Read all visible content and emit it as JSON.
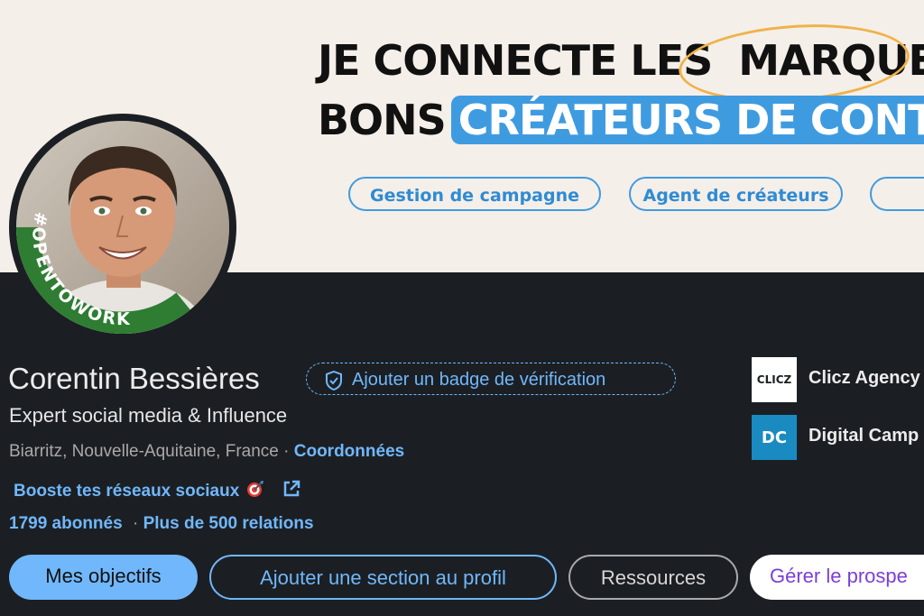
{
  "banner": {
    "line1_part1": "JE CONNECTE LES",
    "line1_part2": "MARQUES A",
    "line2_part1": "BONS",
    "line2_part2": "CRÉATEURS DE CONTEN",
    "pills": [
      "Gestion de campagne",
      "Agent de créateurs",
      ""
    ],
    "colors": {
      "accent_blue": "#3f9be0",
      "highlight_circle": "#f0b24a",
      "banner_bg": "#f5efe9"
    }
  },
  "avatar": {
    "frame_text": "#OPENTOWORK",
    "frame_color": "#2e7d32"
  },
  "profile": {
    "name": "Corentin Bessières",
    "verify_badge_label": "Ajouter un badge de vérification",
    "headline": "Expert social media & Influence",
    "location": "Biarritz, Nouvelle-Aquitaine, France",
    "separator": "·",
    "contact_link": "Coordonnées",
    "website_link": "Booste tes réseaux sociaux",
    "followers": "1799 abonnés",
    "stats_separator": "·",
    "connections": "Plus de 500 relations"
  },
  "actions": {
    "goals": "Mes objectifs",
    "add_section": "Ajouter une section au profil",
    "resources": "Ressources",
    "manage_prospects": "Gérer le prospe"
  },
  "companies": [
    {
      "name": "Clicz Agency",
      "logo_text": "CLICZ",
      "logo_bg": "#ffffff"
    },
    {
      "name": "Digital Camp",
      "logo_text": "DC",
      "logo_bg": "#1a8bc1"
    }
  ],
  "icons": {
    "verify": "shield-check-icon",
    "target": "target-emoji-icon",
    "external": "external-link-icon"
  }
}
